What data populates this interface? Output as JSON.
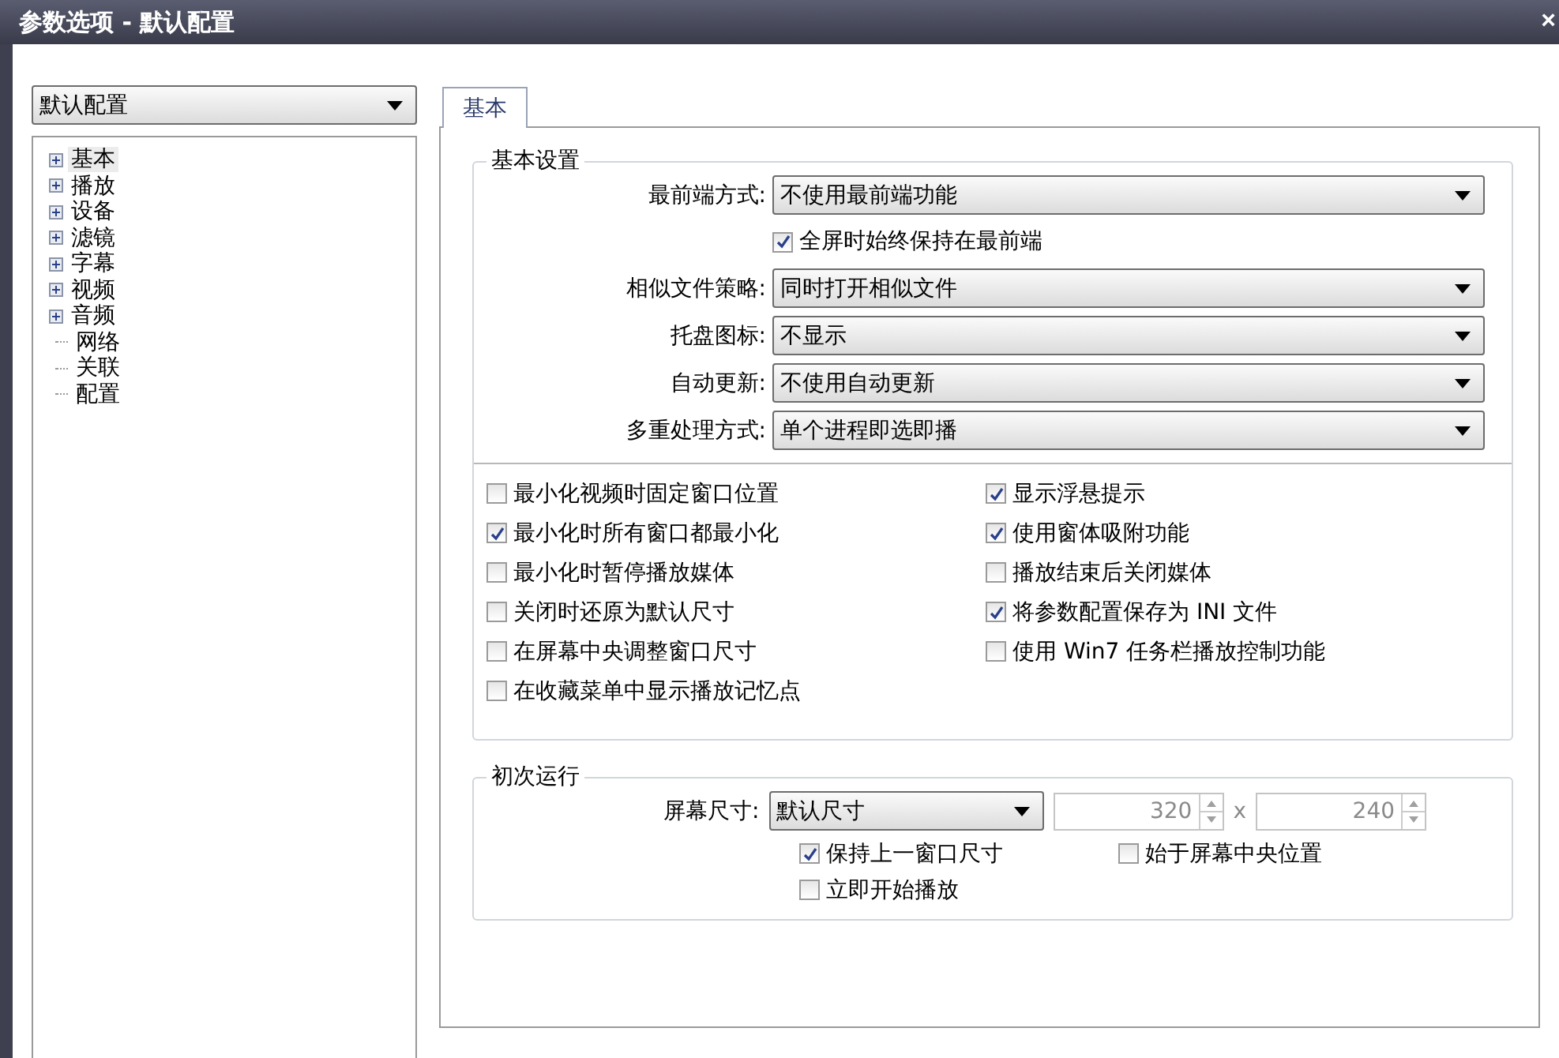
{
  "window": {
    "title": "参数选项 - 默认配置",
    "close": "×"
  },
  "profile": {
    "value": "默认配置"
  },
  "tree": [
    {
      "label": "基本",
      "kind": "group",
      "expanded": false,
      "selected": true
    },
    {
      "label": "播放",
      "kind": "group",
      "expanded": false,
      "selected": false
    },
    {
      "label": "设备",
      "kind": "group",
      "expanded": false,
      "selected": false
    },
    {
      "label": "滤镜",
      "kind": "group",
      "expanded": false,
      "selected": false
    },
    {
      "label": "字幕",
      "kind": "group",
      "expanded": false,
      "selected": false
    },
    {
      "label": "视频",
      "kind": "group",
      "expanded": false,
      "selected": false
    },
    {
      "label": "音频",
      "kind": "group",
      "expanded": false,
      "selected": false
    },
    {
      "label": "网络",
      "kind": "leaf",
      "selected": false
    },
    {
      "label": "关联",
      "kind": "leaf",
      "selected": false
    },
    {
      "label": "配置",
      "kind": "leaf",
      "selected": false
    }
  ],
  "tabs": [
    {
      "label": "基本",
      "selected": true
    }
  ],
  "basic": {
    "title": "基本设置",
    "rows": [
      {
        "kind": "select",
        "label": "最前端方式:",
        "value": "不使用最前端功能"
      },
      {
        "kind": "check",
        "label": "全屏时始终保持在最前端",
        "checked": true
      },
      {
        "kind": "select",
        "label": "相似文件策略:",
        "value": "同时打开相似文件"
      },
      {
        "kind": "select",
        "label": "托盘图标:",
        "value": "不显示"
      },
      {
        "kind": "select",
        "label": "自动更新:",
        "value": "不使用自动更新"
      },
      {
        "kind": "select",
        "label": "多重处理方式:",
        "value": "单个进程即选即播"
      }
    ],
    "options_left": [
      {
        "label": "最小化视频时固定窗口位置",
        "checked": false
      },
      {
        "label": "最小化时所有窗口都最小化",
        "checked": true
      },
      {
        "label": "最小化时暂停播放媒体",
        "checked": false
      },
      {
        "label": "关闭时还原为默认尺寸",
        "checked": false
      },
      {
        "label": "在屏幕中央调整窗口尺寸",
        "checked": false
      },
      {
        "label": "在收藏菜单中显示播放记忆点",
        "checked": false
      }
    ],
    "options_right": [
      {
        "label": "显示浮悬提示",
        "checked": true
      },
      {
        "label": "使用窗体吸附功能",
        "checked": true
      },
      {
        "label": "播放结束后关闭媒体",
        "checked": false
      },
      {
        "label": "将参数配置保存为 INI 文件",
        "checked": true
      },
      {
        "label": "使用 Win7 任务栏播放控制功能",
        "checked": false
      }
    ]
  },
  "first_run": {
    "title": "初次运行",
    "size_label": "屏幕尺寸:",
    "size_value": "默认尺寸",
    "width": {
      "value": "320",
      "disabled": true
    },
    "separator": "x",
    "height": {
      "value": "240",
      "disabled": true
    },
    "options": [
      {
        "label": "保持上一窗口尺寸",
        "checked": true
      },
      {
        "label": "始于屏幕中央位置",
        "checked": false
      },
      {
        "label": "立即开始播放",
        "checked": false
      }
    ]
  }
}
